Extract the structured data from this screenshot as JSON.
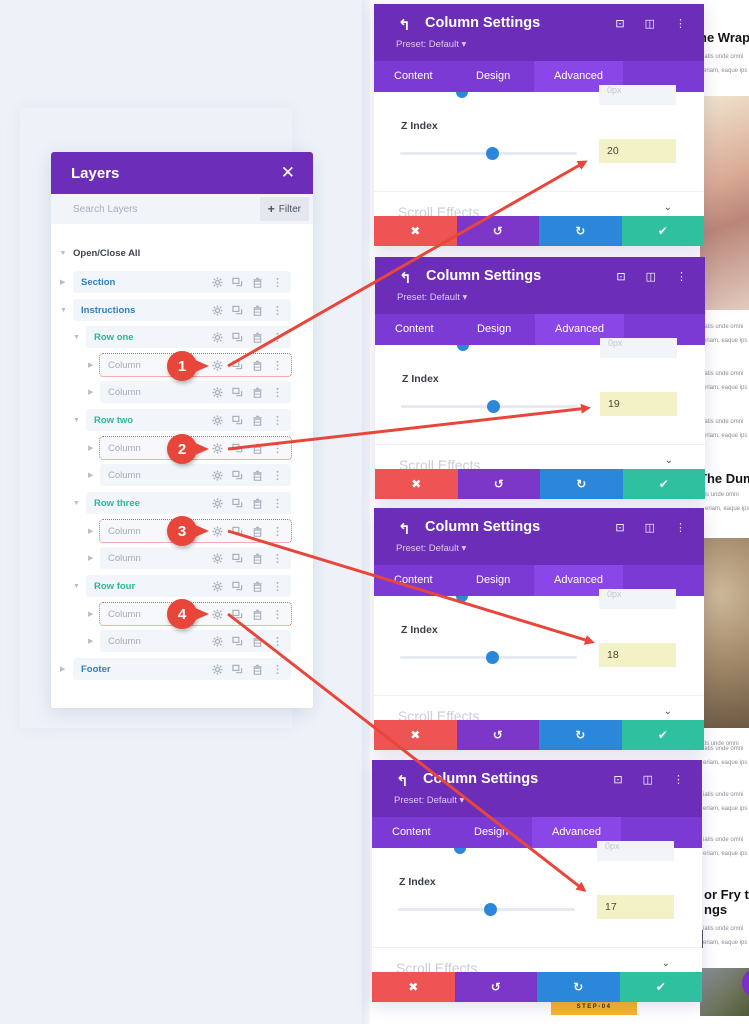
{
  "layers": {
    "title": "Layers",
    "search_placeholder": "Search Layers",
    "filter_label": "Filter",
    "open_close_all": "Open/Close All",
    "items": [
      {
        "label": "Section",
        "type": "section"
      },
      {
        "label": "Instructions",
        "type": "section"
      },
      {
        "label": "Row one",
        "type": "row"
      },
      {
        "label": "Column",
        "type": "column",
        "highlighted": true,
        "callout": "1"
      },
      {
        "label": "Column",
        "type": "column"
      },
      {
        "label": "Row two",
        "type": "row"
      },
      {
        "label": "Column",
        "type": "column",
        "highlighted": true,
        "callout": "2"
      },
      {
        "label": "Column",
        "type": "column"
      },
      {
        "label": "Row three",
        "type": "row"
      },
      {
        "label": "Column",
        "type": "column",
        "highlighted": true,
        "callout": "3"
      },
      {
        "label": "Column",
        "type": "column"
      },
      {
        "label": "Row four",
        "type": "row"
      },
      {
        "label": "Column",
        "type": "column",
        "highlighted": true,
        "callout": "4"
      },
      {
        "label": "Column",
        "type": "column"
      },
      {
        "label": "Footer",
        "type": "section"
      }
    ],
    "row_icons": [
      "gear-icon",
      "duplicate-icon",
      "trash-icon",
      "more-vertical-icon"
    ]
  },
  "settings_panels": [
    {
      "title": "Column Settings",
      "preset": "Preset: Default",
      "tabs": [
        "Content",
        "Design",
        "Advanced"
      ],
      "active_tab": "Advanced",
      "ghost_value": "0px",
      "z_label": "Z Index",
      "z_value": "20",
      "slider_fraction": 0.52,
      "section_label": "Scroll Effects"
    },
    {
      "title": "Column Settings",
      "preset": "Preset: Default",
      "tabs": [
        "Content",
        "Design",
        "Advanced"
      ],
      "active_tab": "Advanced",
      "ghost_value": "0px",
      "z_label": "Z Index",
      "z_value": "19",
      "slider_fraction": 0.52,
      "section_label": "Scroll Effects"
    },
    {
      "title": "Column Settings",
      "preset": "Preset: Default",
      "tabs": [
        "Content",
        "Design",
        "Advanced"
      ],
      "active_tab": "Advanced",
      "ghost_value": "0px",
      "z_label": "Z Index",
      "z_value": "18",
      "slider_fraction": 0.52,
      "section_label": "Scroll Effects"
    },
    {
      "title": "Column Settings",
      "preset": "Preset: Default",
      "tabs": [
        "Content",
        "Design",
        "Advanced"
      ],
      "active_tab": "Advanced",
      "ghost_value": "0px",
      "z_label": "Z Index",
      "z_value": "17",
      "slider_fraction": 0.52,
      "section_label": "Scroll Effects"
    }
  ],
  "footer_icons": [
    "close-icon",
    "undo-icon",
    "redo-icon",
    "check-icon"
  ],
  "page_content": {
    "headings": [
      "he Wrap",
      "The Dum",
      "or Fry th",
      "ngs"
    ],
    "para_line1": "iatis unde omni",
    "para_line2": "eriam, eaque ips",
    "para_intro": "Sed ut perspiciatis unde omni",
    "step_badge": "STEP-04"
  },
  "colors": {
    "brand_purple": "#6c2eb9",
    "tab_purple": "#7b3ad3",
    "active_tab": "#8b46e8",
    "cancel": "#ef5454",
    "undo": "#7d37c8",
    "redo": "#2b87da",
    "save": "#2fc0a0",
    "annotation": "#e8463b",
    "highlight_field": "#f3f1c6"
  }
}
